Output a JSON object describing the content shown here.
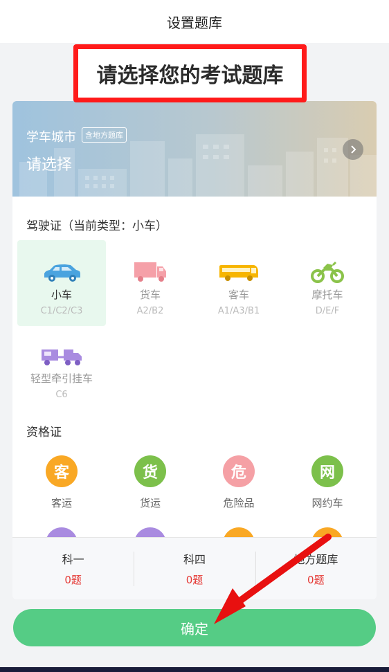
{
  "header": {
    "title": "设置题库"
  },
  "callout": {
    "text": "请选择您的考试题库"
  },
  "banner": {
    "city_label": "学车城市",
    "badge": "含地方题库",
    "choose": "请选择"
  },
  "license": {
    "title": "驾驶证（当前类型：小车）",
    "items": [
      {
        "name": "小车",
        "code": "C1/C2/C3",
        "selected": true,
        "icon": "car-icon",
        "color": "#4aa3df"
      },
      {
        "name": "货车",
        "code": "A2/B2",
        "selected": false,
        "icon": "truck-icon",
        "color": "#f5a0a8"
      },
      {
        "name": "客车",
        "code": "A1/A3/B1",
        "selected": false,
        "icon": "bus-icon",
        "color": "#f7b500"
      },
      {
        "name": "摩托车",
        "code": "D/E/F",
        "selected": false,
        "icon": "motorcycle-icon",
        "color": "#8bc34a"
      },
      {
        "name": "轻型牵引挂车",
        "code": "C6",
        "selected": false,
        "icon": "trailer-icon",
        "color": "#a98be0"
      }
    ]
  },
  "qualification": {
    "title": "资格证",
    "items": [
      {
        "char": "客",
        "label": "客运",
        "color": "#f9a825"
      },
      {
        "char": "货",
        "label": "货运",
        "color": "#7cc04b"
      },
      {
        "char": "危",
        "label": "危险品",
        "color": "#f5a0a5"
      },
      {
        "char": "网",
        "label": "网约车",
        "color": "#7cc04b"
      }
    ],
    "partial_colors": [
      "#a98be0",
      "#a98be0",
      "#f9a825",
      "#f9a825"
    ]
  },
  "stats": [
    {
      "name": "科一",
      "count": "0题"
    },
    {
      "name": "科四",
      "count": "0题"
    },
    {
      "name": "地方题库",
      "count": "0题"
    }
  ],
  "confirm": {
    "label": "确定"
  },
  "colors": {
    "accent": "#55cc85",
    "callout_border": "#ff1a1a",
    "count_red": "#e53935"
  }
}
